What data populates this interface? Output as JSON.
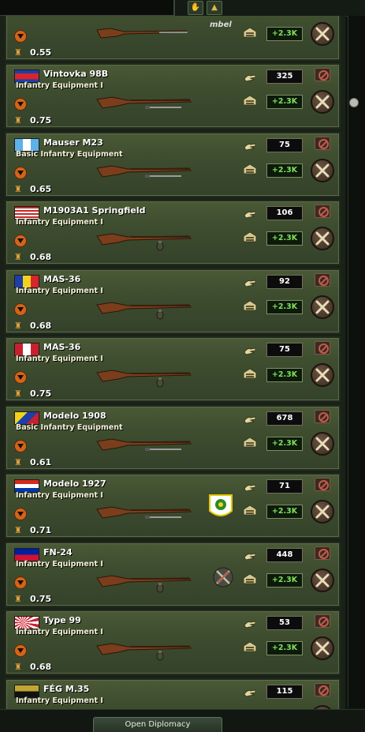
{
  "diplomacy_button": "Open Diplomacy",
  "colors": {
    "card": "#3f4e2f",
    "production": "#7fe05a",
    "accent_orange": "#d0651c"
  },
  "top_partial_card": {
    "cost": "0.55",
    "production": "+2.3K",
    "logo_text": "mbel"
  },
  "cards": [
    {
      "name": "Vintovka 98B",
      "equipment": "Infantry Equipment I",
      "cost": "0.75",
      "quantity": "325",
      "production": "+2.3K",
      "flag": "cambodia",
      "rifle": "rifle-with-bayonet"
    },
    {
      "name": "Mauser M23",
      "equipment": "Basic Infantry Equipment",
      "cost": "0.65",
      "quantity": "75",
      "production": "+2.3K",
      "flag": "guatemala",
      "rifle": "rifle-with-bayonet"
    },
    {
      "name": "M1903A1 Springfield",
      "equipment": "Infantry Equipment I",
      "cost": "0.68",
      "quantity": "106",
      "production": "+2.3K",
      "flag": "usa",
      "rifle": "rifle-with-grenade"
    },
    {
      "name": "MAS-36",
      "equipment": "Infantry Equipment I",
      "cost": "0.68",
      "quantity": "92",
      "production": "+2.3K",
      "flag": "andorra",
      "rifle": "rifle-with-grenade"
    },
    {
      "name": "MAS-36",
      "equipment": "Infantry Equipment I",
      "cost": "0.75",
      "quantity": "75",
      "production": "+2.3K",
      "flag": "peru",
      "rifle": "rifle-with-grenade"
    },
    {
      "name": "Modelo 1908",
      "equipment": "Basic Infantry Equipment",
      "cost": "0.61",
      "quantity": "678",
      "production": "+2.3K",
      "flag": "colombia",
      "rifle": "rifle-with-bayonet"
    },
    {
      "name": "Modelo 1927",
      "equipment": "Infantry Equipment I",
      "cost": "0.71",
      "quantity": "71",
      "production": "+2.3K",
      "flag": "paraguay",
      "rifle": "rifle-with-bayonet",
      "extra": "company-emblem"
    },
    {
      "name": "FN-24",
      "equipment": "Infantry Equipment I",
      "cost": "0.75",
      "quantity": "448",
      "production": "+2.3K",
      "flag": "haiti",
      "rifle": "rifle-with-grenade",
      "extra": "crossed-rifles-badge"
    },
    {
      "name": "Type 99",
      "equipment": "Infantry Equipment I",
      "cost": "0.68",
      "quantity": "53",
      "production": "+2.3K",
      "flag": "japan",
      "rifle": "rifle-with-grenade"
    },
    {
      "name": "FÉG M.35",
      "equipment": "Infantry Equipment I",
      "cost": "",
      "quantity": "115",
      "production": "",
      "flag": "hungary",
      "rifle": "rifle"
    }
  ]
}
